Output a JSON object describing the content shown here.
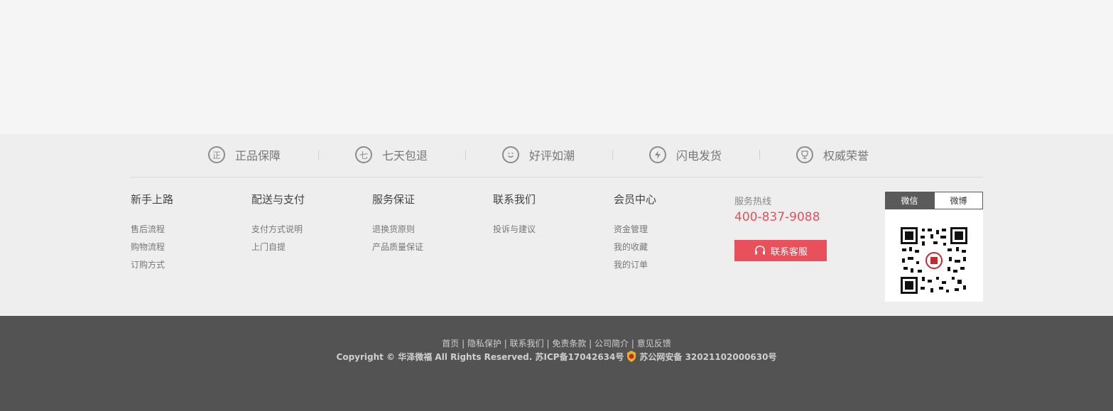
{
  "guarantees": [
    {
      "icon": "正",
      "label": "正品保障"
    },
    {
      "icon": "七",
      "label": "七天包退"
    },
    {
      "icon": "smile",
      "label": "好评如潮"
    },
    {
      "icon": "lightning",
      "label": "闪电发货"
    },
    {
      "icon": "trophy",
      "label": "权威荣誉"
    }
  ],
  "columns": [
    {
      "title": "新手上路",
      "links": [
        "售后流程",
        "购物流程",
        "订购方式"
      ]
    },
    {
      "title": "配送与支付",
      "links": [
        "支付方式说明",
        "上门自提"
      ]
    },
    {
      "title": "服务保证",
      "links": [
        "退换货原则",
        "产品质量保证"
      ]
    },
    {
      "title": "联系我们",
      "links": [
        "投诉与建议"
      ]
    },
    {
      "title": "会员中心",
      "links": [
        "资金管理",
        "我的收藏",
        "我的订单"
      ]
    }
  ],
  "hotline": {
    "label": "服务热线",
    "number": "400-837-9088",
    "button": "联系客服"
  },
  "qr": {
    "tab_active": "微信",
    "tab_inactive": "微博"
  },
  "bottom": {
    "links": [
      "首页",
      "隐私保护",
      "联系我们",
      "免责条款",
      "公司简介",
      "意见反馈"
    ],
    "copyright": "Copyright © 华泽微福 All Rights Reserved. 苏ICP备17042634号",
    "police": "苏公网安备 32021102000630号"
  },
  "colors": {
    "accent": "#e8505b",
    "footer_bg": "#eeeeee",
    "bottom_bg": "#535353"
  }
}
